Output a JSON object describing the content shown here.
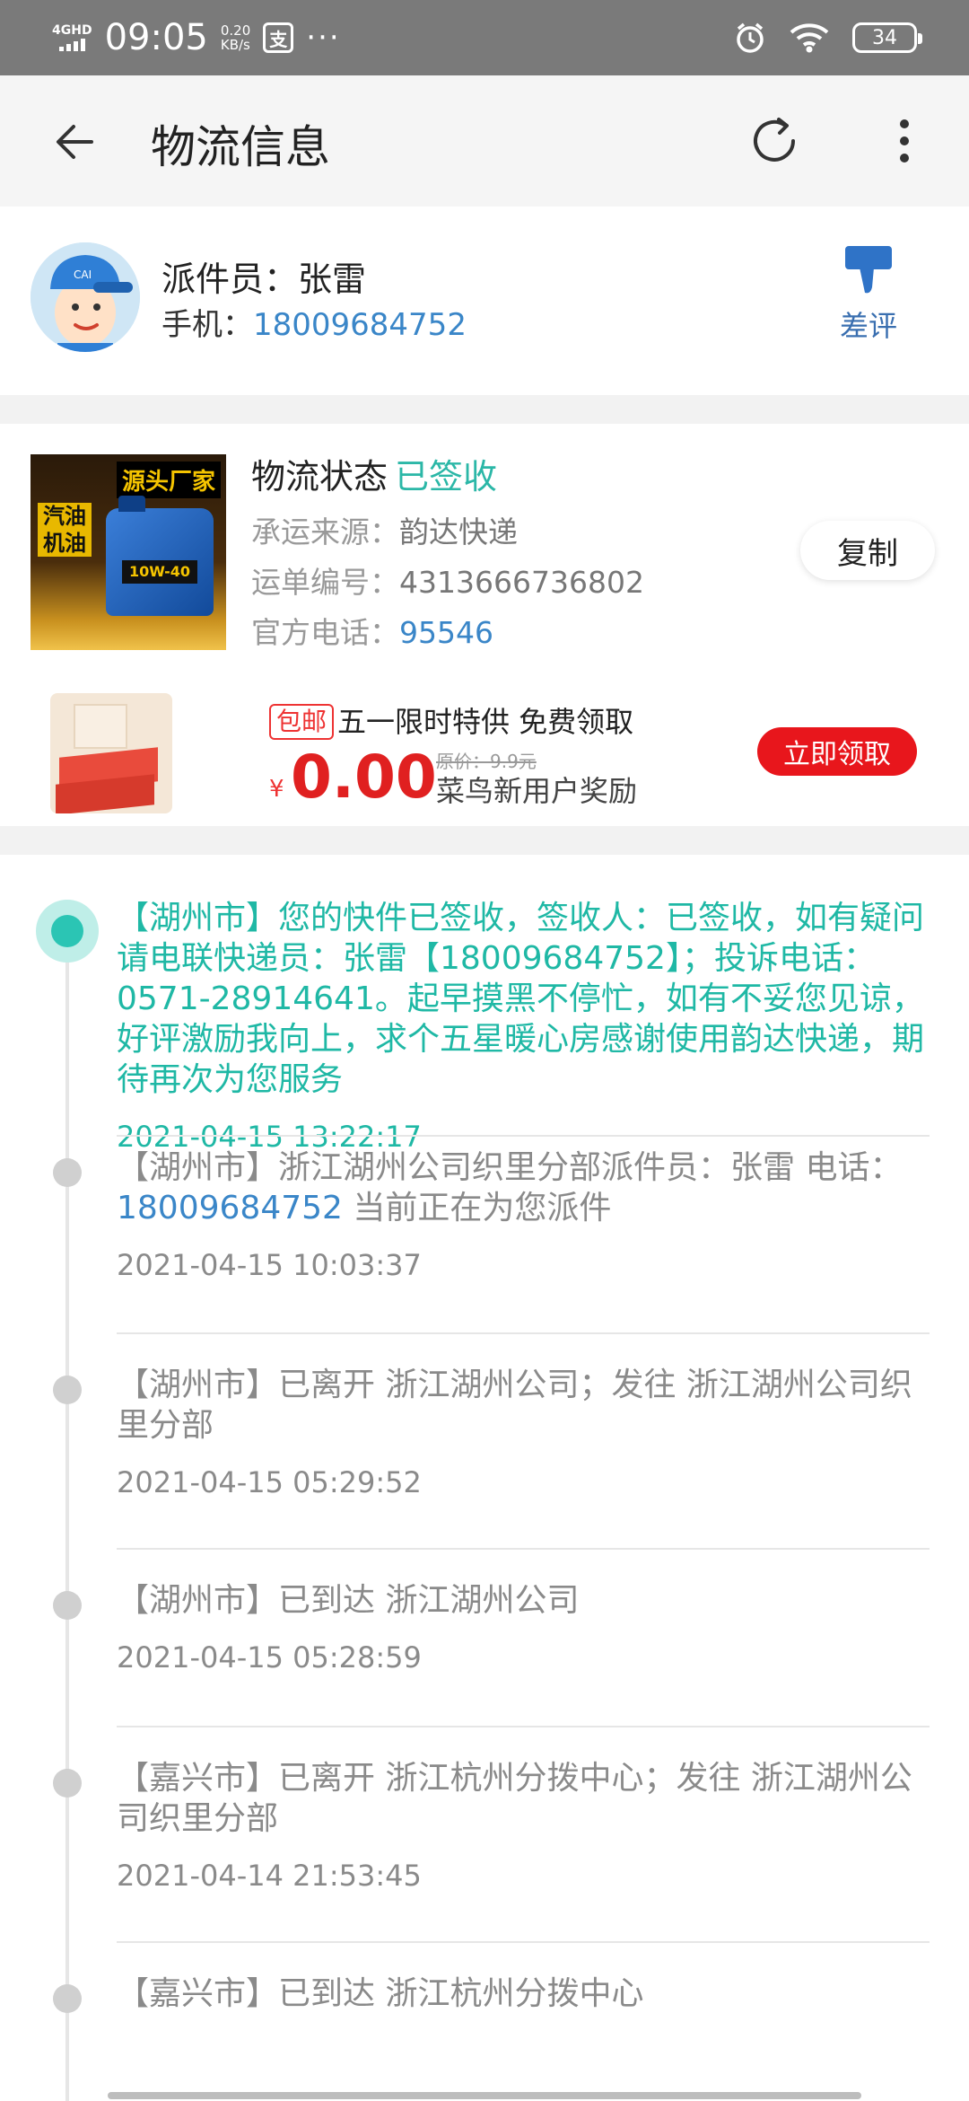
{
  "status_bar": {
    "network": "4GHD",
    "time": "09:05",
    "speed_value": "0.20",
    "speed_unit": "KB/s",
    "app_icon": "支",
    "more": "···",
    "battery": "34"
  },
  "header": {
    "title": "物流信息"
  },
  "courier": {
    "name_label": "派件员：张雷",
    "phone_label": "手机：",
    "phone": "18009684752",
    "bad_review_label": "差评"
  },
  "logistics": {
    "status_label": "物流状态",
    "status_value": "已签收",
    "carrier_label": "承运来源：",
    "carrier": "韵达快递",
    "tracking_label": "运单编号：",
    "tracking_number": "4313666736802",
    "hotline_label": "官方电话：",
    "hotline": "95546",
    "copy_button": "复制",
    "product_banner": "源头厂家",
    "product_label": "汽油机油",
    "product_grade": "10W-40"
  },
  "promo": {
    "tag": "包邮",
    "title": "五一限时特供 免费领取",
    "currency": "¥",
    "price": "0.00",
    "original_price": "原价：9.9元",
    "subtitle": "菜鸟新用户奖励",
    "claim_button": "立即领取"
  },
  "timeline": [
    {
      "text_before": "【湖州市】您的快件已签收，签收人：已签收，如有疑问请电联快递员：张雷【18009684752】；投诉电话：0571-28914641。起早摸黑不停忙，如有不妥您见谅，好评激励我向上，求个五星暖心房感谢使用韵达快递，期待再次为您服务",
      "time": "2021-04-15 13:22:17"
    },
    {
      "text_before": "【湖州市】浙江湖州公司织里分部派件员：张雷 电话：",
      "phone": "18009684752",
      "text_after": " 当前正在为您派件",
      "time": "2021-04-15 10:03:37"
    },
    {
      "text_before": "【湖州市】已离开 浙江湖州公司；发往 浙江湖州公司织里分部",
      "time": "2021-04-15 05:29:52"
    },
    {
      "text_before": "【湖州市】已到达 浙江湖州公司",
      "time": "2021-04-15 05:28:59"
    },
    {
      "text_before": "【嘉兴市】已离开 浙江杭州分拨中心；发往 浙江湖州公司织里分部",
      "time": "2021-04-14 21:53:45"
    },
    {
      "text_before": "【嘉兴市】已到达 浙江杭州分拨中心"
    }
  ],
  "colors": {
    "accent_teal": "#1fb8a5",
    "link_blue": "#3a86c8",
    "promo_red": "#e8161c"
  }
}
